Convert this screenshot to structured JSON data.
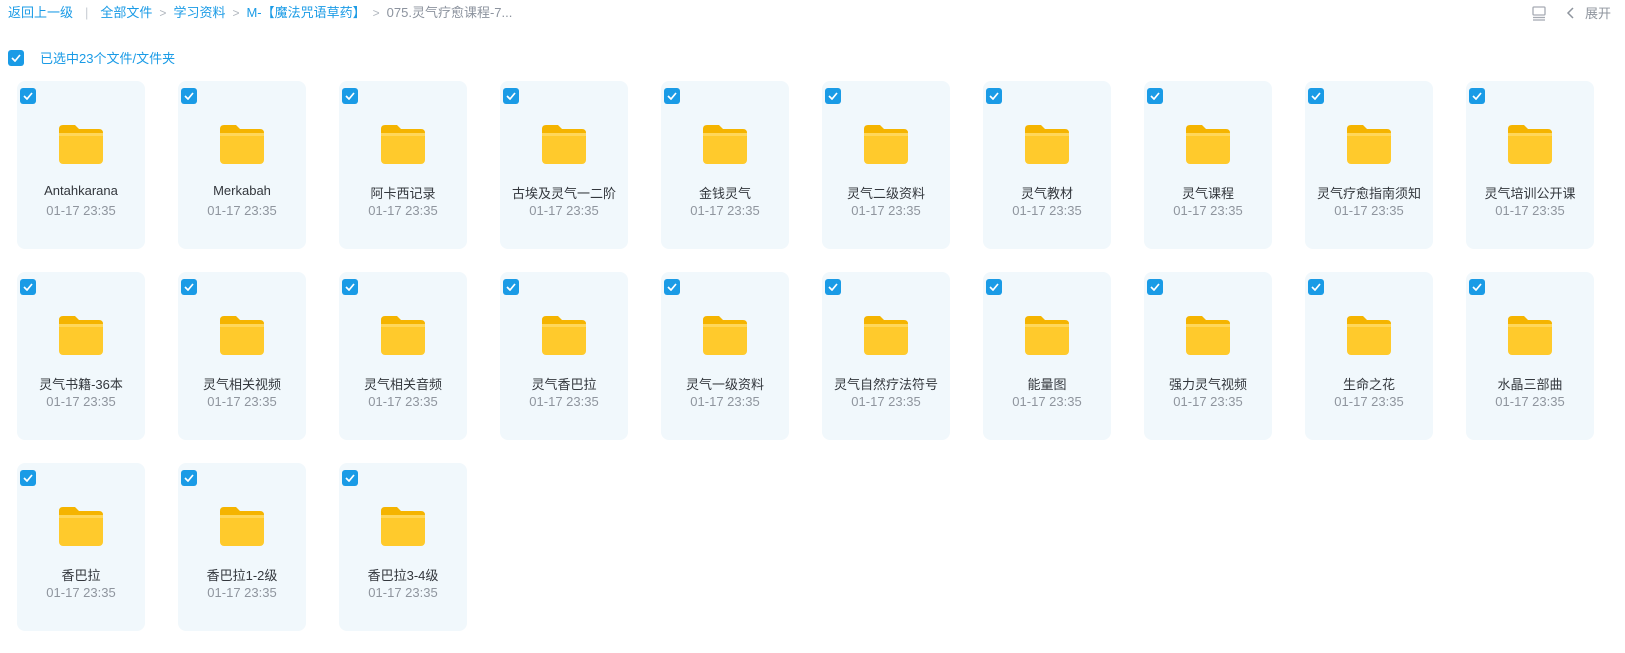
{
  "breadcrumb": {
    "back": "返回上一级",
    "items": [
      "全部文件",
      "学习资料",
      "M-【魔法咒语草药】"
    ],
    "current": "075.灵气疗愈课程-7...",
    "separator": ">"
  },
  "toolbar": {
    "expand_label": "展开",
    "list_view_icon": "list-view-icon",
    "chevron_icon": "chevron-left-icon"
  },
  "selection": {
    "label": "已选中23个文件/文件夹",
    "checked": true
  },
  "colors": {
    "accent": "#1a9be6",
    "tile_bg": "#f1f8fc",
    "folder": "#ffca2c"
  },
  "files": [
    {
      "name": "Antahkarana",
      "date": "01-17 23:35",
      "checked": true
    },
    {
      "name": "Merkabah",
      "date": "01-17 23:35",
      "checked": true
    },
    {
      "name": "阿卡西记录",
      "date": "01-17 23:35",
      "checked": true
    },
    {
      "name": "古埃及灵气一二阶",
      "date": "01-17 23:35",
      "checked": true
    },
    {
      "name": "金钱灵气",
      "date": "01-17 23:35",
      "checked": true
    },
    {
      "name": "灵气二级资料",
      "date": "01-17 23:35",
      "checked": true
    },
    {
      "name": "灵气教材",
      "date": "01-17 23:35",
      "checked": true
    },
    {
      "name": "灵气课程",
      "date": "01-17 23:35",
      "checked": true
    },
    {
      "name": "灵气疗愈指南须知",
      "date": "01-17 23:35",
      "checked": true
    },
    {
      "name": "灵气培训公开课",
      "date": "01-17 23:35",
      "checked": true
    },
    {
      "name": "灵气书籍-36本",
      "date": "01-17 23:35",
      "checked": true
    },
    {
      "name": "灵气相关视频",
      "date": "01-17 23:35",
      "checked": true
    },
    {
      "name": "灵气相关音频",
      "date": "01-17 23:35",
      "checked": true
    },
    {
      "name": "灵气香巴拉",
      "date": "01-17 23:35",
      "checked": true
    },
    {
      "name": "灵气一级资料",
      "date": "01-17 23:35",
      "checked": true
    },
    {
      "name": "灵气自然疗法符号",
      "date": "01-17 23:35",
      "checked": true
    },
    {
      "name": "能量图",
      "date": "01-17 23:35",
      "checked": true
    },
    {
      "name": "强力灵气视频",
      "date": "01-17 23:35",
      "checked": true
    },
    {
      "name": "生命之花",
      "date": "01-17 23:35",
      "checked": true
    },
    {
      "name": "水晶三部曲",
      "date": "01-17 23:35",
      "checked": true
    },
    {
      "name": "香巴拉",
      "date": "01-17 23:35",
      "checked": true
    },
    {
      "name": "香巴拉1-2级",
      "date": "01-17 23:35",
      "checked": true
    },
    {
      "name": "香巴拉3-4级",
      "date": "01-17 23:35",
      "checked": true
    }
  ]
}
